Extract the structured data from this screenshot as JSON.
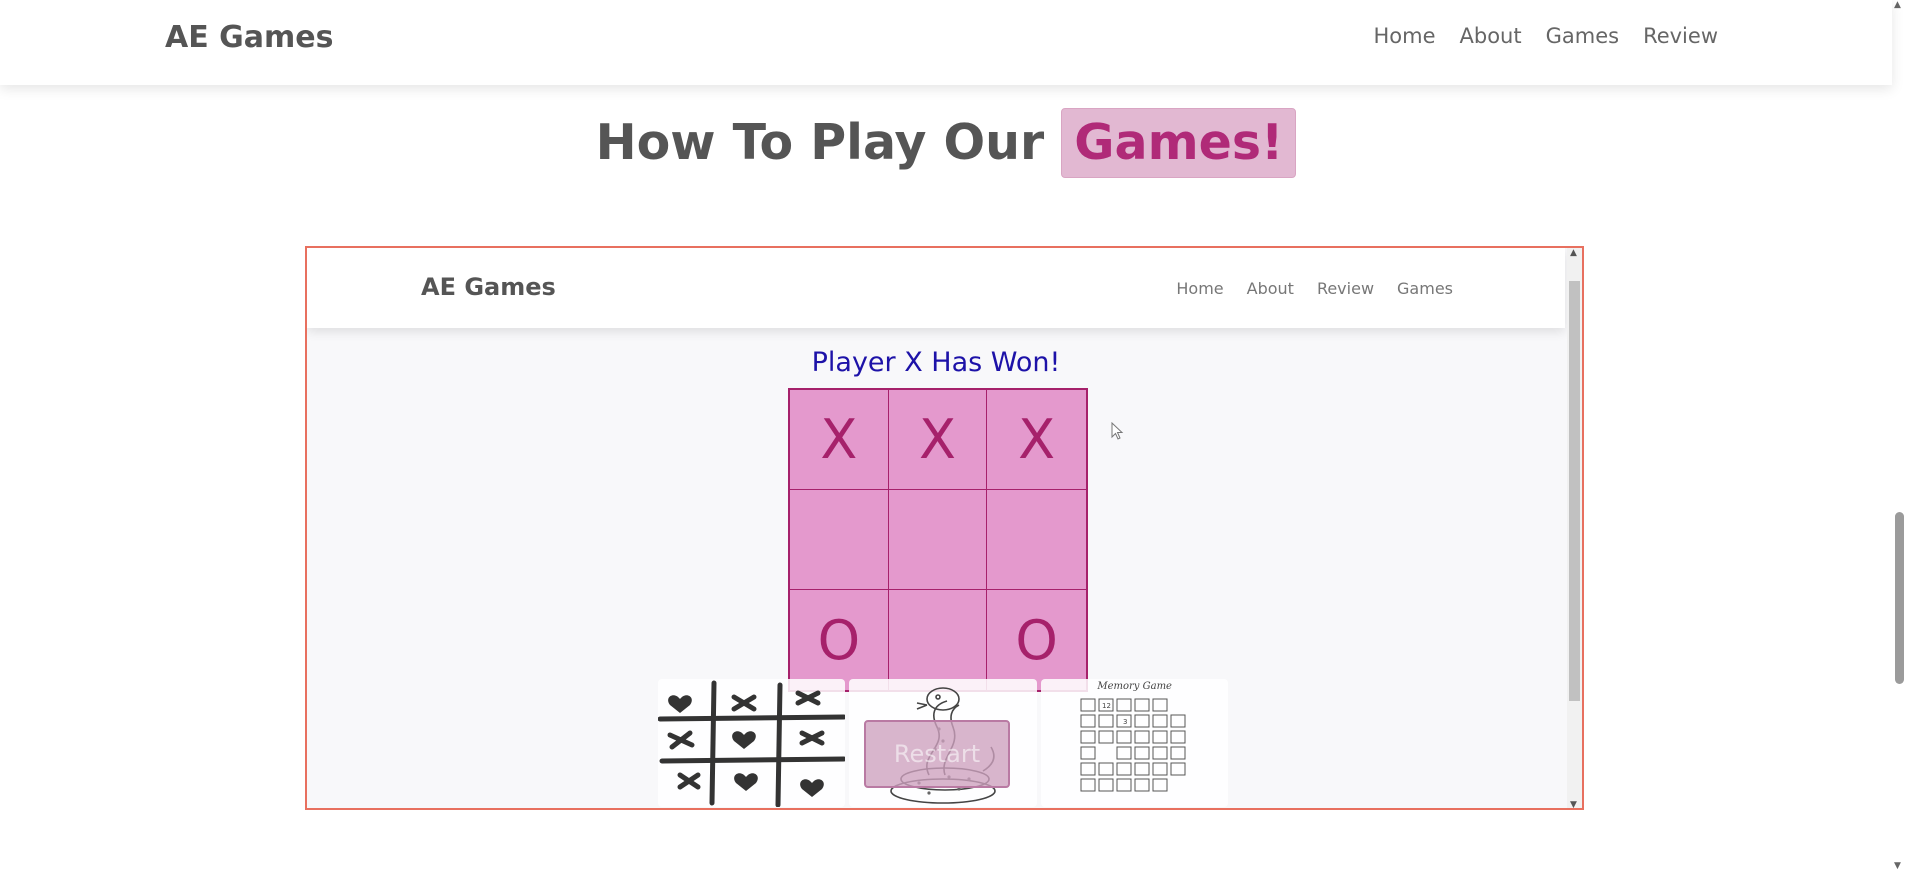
{
  "navbar": {
    "brand": "AE Games",
    "links": [
      "Home",
      "About",
      "Games",
      "Review"
    ]
  },
  "heading": {
    "text": "How To Play Our",
    "highlight": "Games!"
  },
  "demo": {
    "navbar": {
      "brand": "AE Games",
      "links": [
        "Home",
        "About",
        "Review",
        "Games"
      ]
    },
    "status": "Player X Has Won!",
    "board": [
      "X",
      "X",
      "X",
      "",
      "",
      "",
      "O",
      "",
      "O"
    ],
    "restart_label": "Restart",
    "thumbnails": {
      "memory_title": "Memory Game",
      "memory_numbers": [
        "12",
        "3"
      ]
    }
  },
  "colors": {
    "accent": "#b02a78",
    "board_bg": "#e499cd",
    "status": "#1d12a8",
    "frame_border": "#e8705f"
  }
}
